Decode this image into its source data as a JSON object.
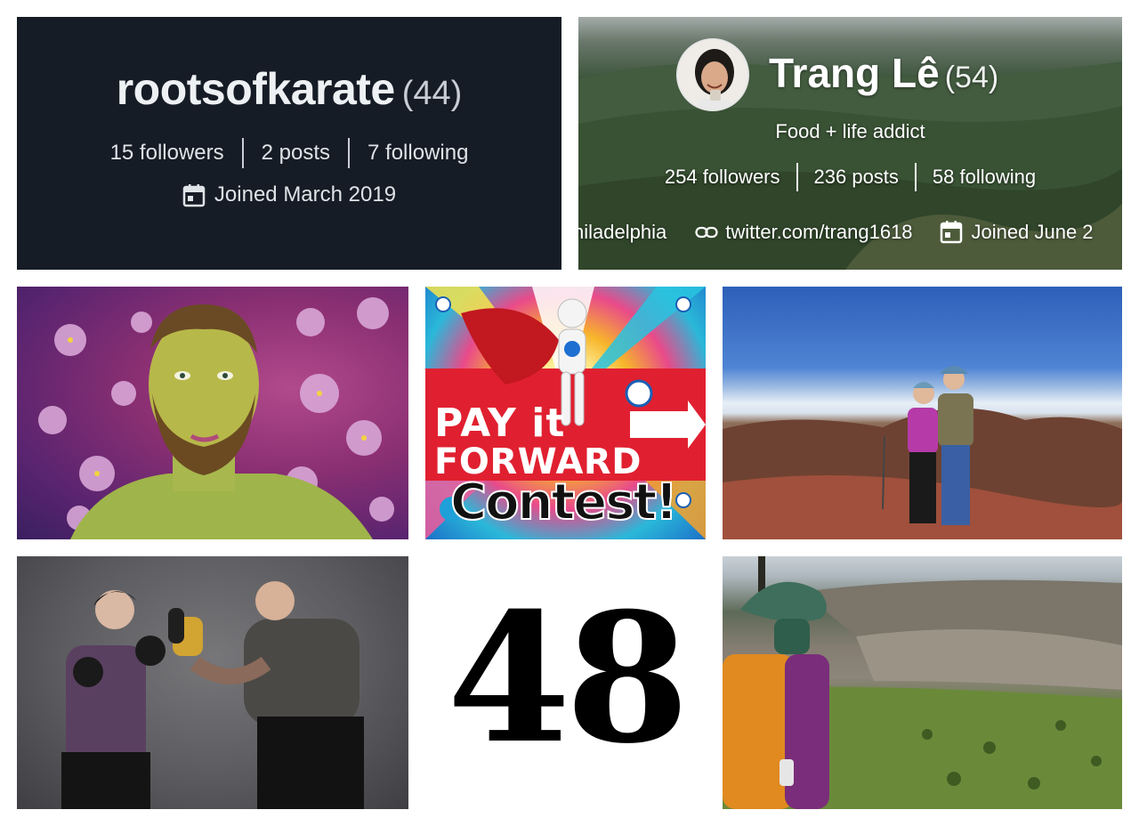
{
  "roots_card": {
    "username": "rootsofkarate",
    "reputation": "(44)",
    "followers": "15 followers",
    "posts": "2 posts",
    "following": "7 following",
    "joined": "Joined March 2019",
    "background_color": "#161c25"
  },
  "trang_card": {
    "name": "Trang Lê",
    "reputation": "(54)",
    "bio": "Food + life addict",
    "followers": "254 followers",
    "posts": "236 posts",
    "following": "58 following",
    "location": "hiladelphia",
    "website": "twitter.com/trang1618",
    "joined": "Joined June 2"
  },
  "payit_forward": {
    "line1": "PAY it",
    "line2": "FORWARD",
    "line3": "Contest!"
  },
  "big_number": {
    "value": "48"
  },
  "icons": {
    "calendar": "calendar-icon",
    "link": "link-icon",
    "steem_coin": "steem-coin-icon"
  }
}
